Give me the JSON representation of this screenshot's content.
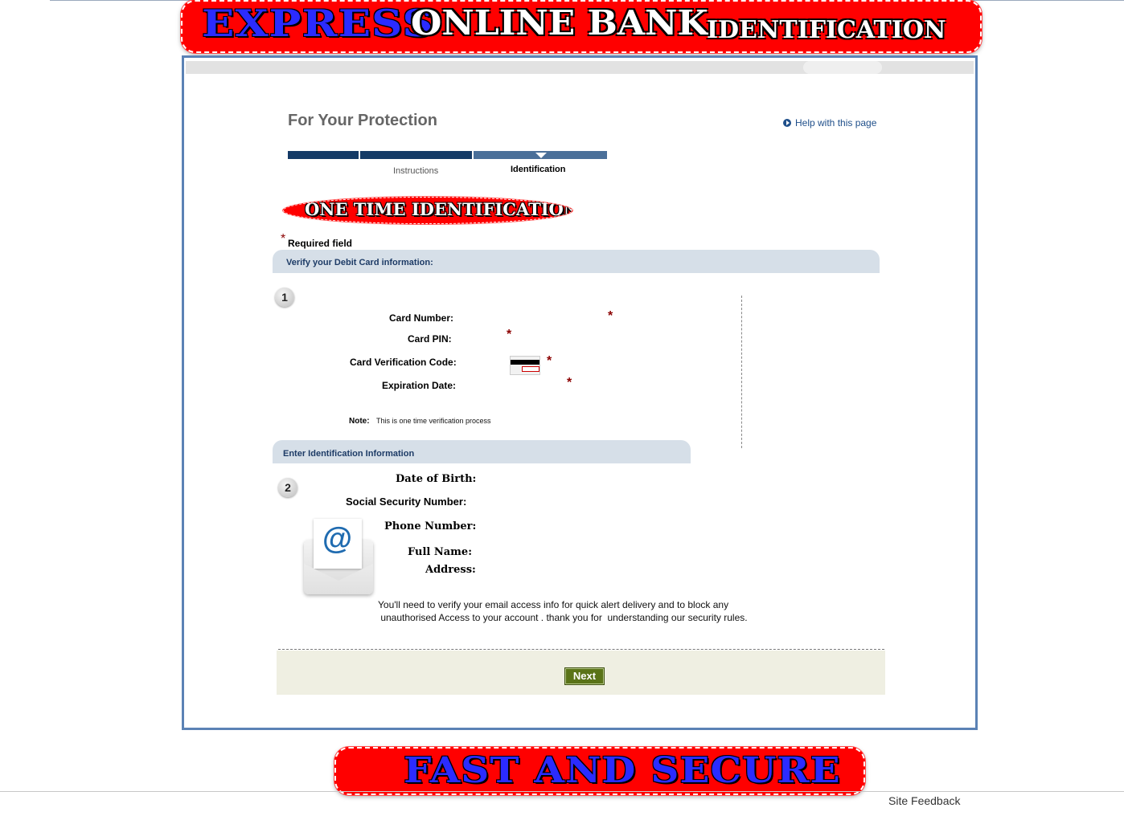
{
  "header_banner": {
    "word1": "EXPRESS",
    "word2": "ONLINE BANK",
    "word3": "IDENTIFICATION"
  },
  "page": {
    "title": "For Your Protection",
    "help_link": "Help with this page"
  },
  "progress": {
    "steps": [
      "",
      "Instructions",
      "Identification"
    ]
  },
  "one_time_banner": "ONE TIME IDENTIFICATION",
  "required": {
    "star": "*",
    "label": "Required field"
  },
  "section1": {
    "number": "1",
    "header": "Verify your Debit Card information:",
    "fields": {
      "card_number": "Card Number:",
      "card_pin": "Card PIN:",
      "cvv": "Card Verification Code:",
      "expiration": "Expiration Date:"
    },
    "note_label": "Note:",
    "note_text": "This is one time verification process"
  },
  "section2": {
    "number": "2",
    "header": "Enter Identification Information",
    "fields": {
      "dob": "Date of Birth:",
      "ssn": "Social  Security Number:",
      "phone": "Phone Number:",
      "full_name": "Full Name:",
      "address": "Address:"
    },
    "message_line1": "You'll need to verify your email access info for quick alert delivery and to block any",
    "message_line2": " unauthorised Access to your account . thank you for  understanding our security rules."
  },
  "actions": {
    "next": "Next"
  },
  "footer_banner": "FAST AND SECURE",
  "site_feedback": "Site Feedback",
  "colors": {
    "banner_red": "#ff0000",
    "frame_blue": "#5b82b5",
    "step_dark": "#143a66",
    "section_bg": "#d6dfe8",
    "button_green": "#5a7318"
  }
}
